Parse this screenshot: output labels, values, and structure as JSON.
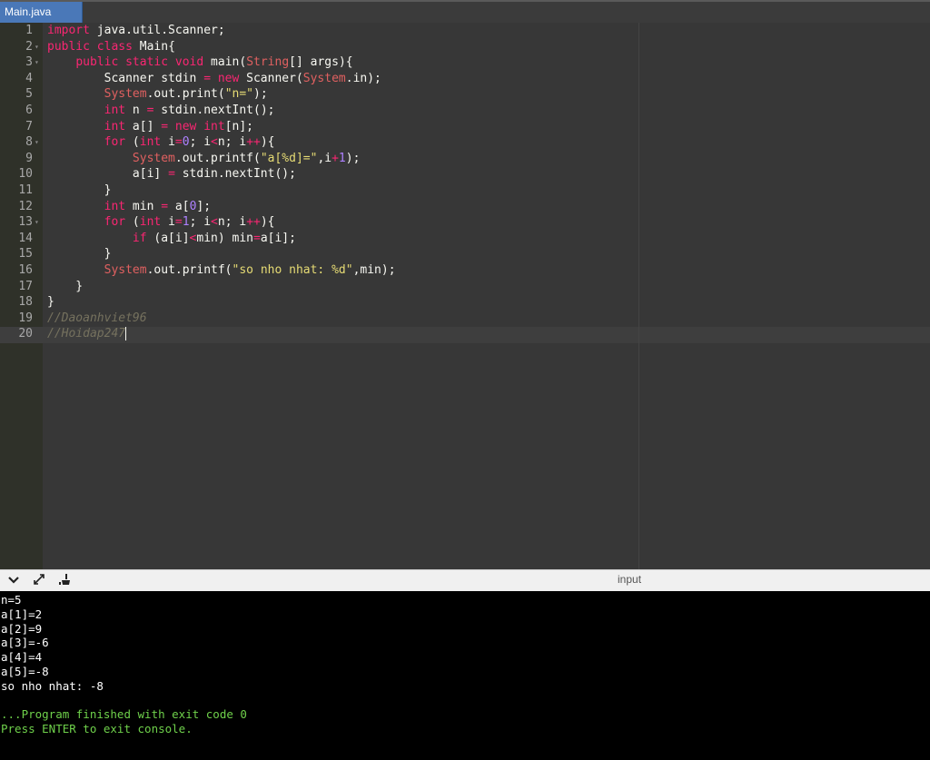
{
  "tabs": [
    {
      "label": "Main.java",
      "active": true
    }
  ],
  "editor": {
    "line_numbers": [
      "1",
      "2",
      "3",
      "4",
      "5",
      "6",
      "7",
      "8",
      "9",
      "10",
      "11",
      "12",
      "13",
      "14",
      "15",
      "16",
      "17",
      "18",
      "19",
      "20"
    ],
    "fold_lines": [
      2,
      3,
      8,
      13
    ],
    "lines": [
      [
        [
          "kw",
          "import"
        ],
        [
          "plain",
          " java.util.Scanner;"
        ]
      ],
      [
        [
          "kw",
          "public"
        ],
        [
          "plain",
          " "
        ],
        [
          "kw",
          "class"
        ],
        [
          "plain",
          " Main{"
        ]
      ],
      [
        [
          "plain",
          "    "
        ],
        [
          "kw",
          "public"
        ],
        [
          "plain",
          " "
        ],
        [
          "kw",
          "static"
        ],
        [
          "plain",
          " "
        ],
        [
          "kw",
          "void"
        ],
        [
          "plain",
          " main("
        ],
        [
          "cls",
          "String"
        ],
        [
          "plain",
          "[] args){"
        ]
      ],
      [
        [
          "plain",
          "        Scanner stdin "
        ],
        [
          "op",
          "="
        ],
        [
          "plain",
          " "
        ],
        [
          "kw",
          "new"
        ],
        [
          "plain",
          " Scanner("
        ],
        [
          "cls",
          "System"
        ],
        [
          "plain",
          ".in);"
        ]
      ],
      [
        [
          "plain",
          "        "
        ],
        [
          "cls",
          "System"
        ],
        [
          "plain",
          ".out.print("
        ],
        [
          "str",
          "\"n=\""
        ],
        [
          "plain",
          ");"
        ]
      ],
      [
        [
          "plain",
          "        "
        ],
        [
          "kw",
          "int"
        ],
        [
          "plain",
          " n "
        ],
        [
          "op",
          "="
        ],
        [
          "plain",
          " stdin.nextInt();"
        ]
      ],
      [
        [
          "plain",
          "        "
        ],
        [
          "kw",
          "int"
        ],
        [
          "plain",
          " a[] "
        ],
        [
          "op",
          "="
        ],
        [
          "plain",
          " "
        ],
        [
          "kw",
          "new"
        ],
        [
          "plain",
          " "
        ],
        [
          "kw",
          "int"
        ],
        [
          "plain",
          "[n];"
        ]
      ],
      [
        [
          "plain",
          "        "
        ],
        [
          "kw",
          "for"
        ],
        [
          "plain",
          " ("
        ],
        [
          "kw",
          "int"
        ],
        [
          "plain",
          " i"
        ],
        [
          "op",
          "="
        ],
        [
          "num",
          "0"
        ],
        [
          "plain",
          "; i"
        ],
        [
          "op",
          "<"
        ],
        [
          "plain",
          "n; i"
        ],
        [
          "op",
          "++"
        ],
        [
          "plain",
          "){"
        ]
      ],
      [
        [
          "plain",
          "            "
        ],
        [
          "cls",
          "System"
        ],
        [
          "plain",
          ".out.printf("
        ],
        [
          "str",
          "\"a[%d]=\""
        ],
        [
          "plain",
          ",i"
        ],
        [
          "op",
          "+"
        ],
        [
          "num",
          "1"
        ],
        [
          "plain",
          ");"
        ]
      ],
      [
        [
          "plain",
          "            a[i] "
        ],
        [
          "op",
          "="
        ],
        [
          "plain",
          " stdin.nextInt();"
        ]
      ],
      [
        [
          "plain",
          "        }"
        ]
      ],
      [
        [
          "plain",
          "        "
        ],
        [
          "kw",
          "int"
        ],
        [
          "plain",
          " min "
        ],
        [
          "op",
          "="
        ],
        [
          "plain",
          " a["
        ],
        [
          "num",
          "0"
        ],
        [
          "plain",
          "];"
        ]
      ],
      [
        [
          "plain",
          "        "
        ],
        [
          "kw",
          "for"
        ],
        [
          "plain",
          " ("
        ],
        [
          "kw",
          "int"
        ],
        [
          "plain",
          " i"
        ],
        [
          "op",
          "="
        ],
        [
          "num",
          "1"
        ],
        [
          "plain",
          "; i"
        ],
        [
          "op",
          "<"
        ],
        [
          "plain",
          "n; i"
        ],
        [
          "op",
          "++"
        ],
        [
          "plain",
          "){"
        ]
      ],
      [
        [
          "plain",
          "            "
        ],
        [
          "kw",
          "if"
        ],
        [
          "plain",
          " (a[i]"
        ],
        [
          "op",
          "<"
        ],
        [
          "plain",
          "min) min"
        ],
        [
          "op",
          "="
        ],
        [
          "plain",
          "a[i];"
        ]
      ],
      [
        [
          "plain",
          "        }"
        ]
      ],
      [
        [
          "plain",
          "        "
        ],
        [
          "cls",
          "System"
        ],
        [
          "plain",
          ".out.printf("
        ],
        [
          "str",
          "\"so nho nhat: %d\""
        ],
        [
          "plain",
          ",min);"
        ]
      ],
      [
        [
          "plain",
          "    }"
        ]
      ],
      [
        [
          "plain",
          "}"
        ]
      ],
      [
        [
          "cmt",
          "//Daoanhviet96"
        ]
      ],
      [
        [
          "cmt",
          "//Hoidap247"
        ]
      ]
    ]
  },
  "panel": {
    "collapse_icon": "chevron-down-icon",
    "expand_icon": "expand-arrows-icon",
    "clear_icon": "broom-icon",
    "input_label": "input"
  },
  "console": {
    "lines": [
      {
        "text": "n=5",
        "color": "white"
      },
      {
        "text": "a[1]=2",
        "color": "white"
      },
      {
        "text": "a[2]=9",
        "color": "white"
      },
      {
        "text": "a[3]=-6",
        "color": "white"
      },
      {
        "text": "a[4]=4",
        "color": "white"
      },
      {
        "text": "a[5]=-8",
        "color": "white"
      },
      {
        "text": "so nho nhat: -8",
        "color": "white"
      },
      {
        "text": "",
        "color": "white"
      },
      {
        "text": "...Program finished with exit code 0",
        "color": "green"
      },
      {
        "text": "Press ENTER to exit console.",
        "color": "green"
      }
    ]
  },
  "colors": {
    "tab_active": "#4a78b8",
    "editor_bg": "#373737",
    "console_bg": "#000000",
    "console_green": "#6fd14b"
  }
}
